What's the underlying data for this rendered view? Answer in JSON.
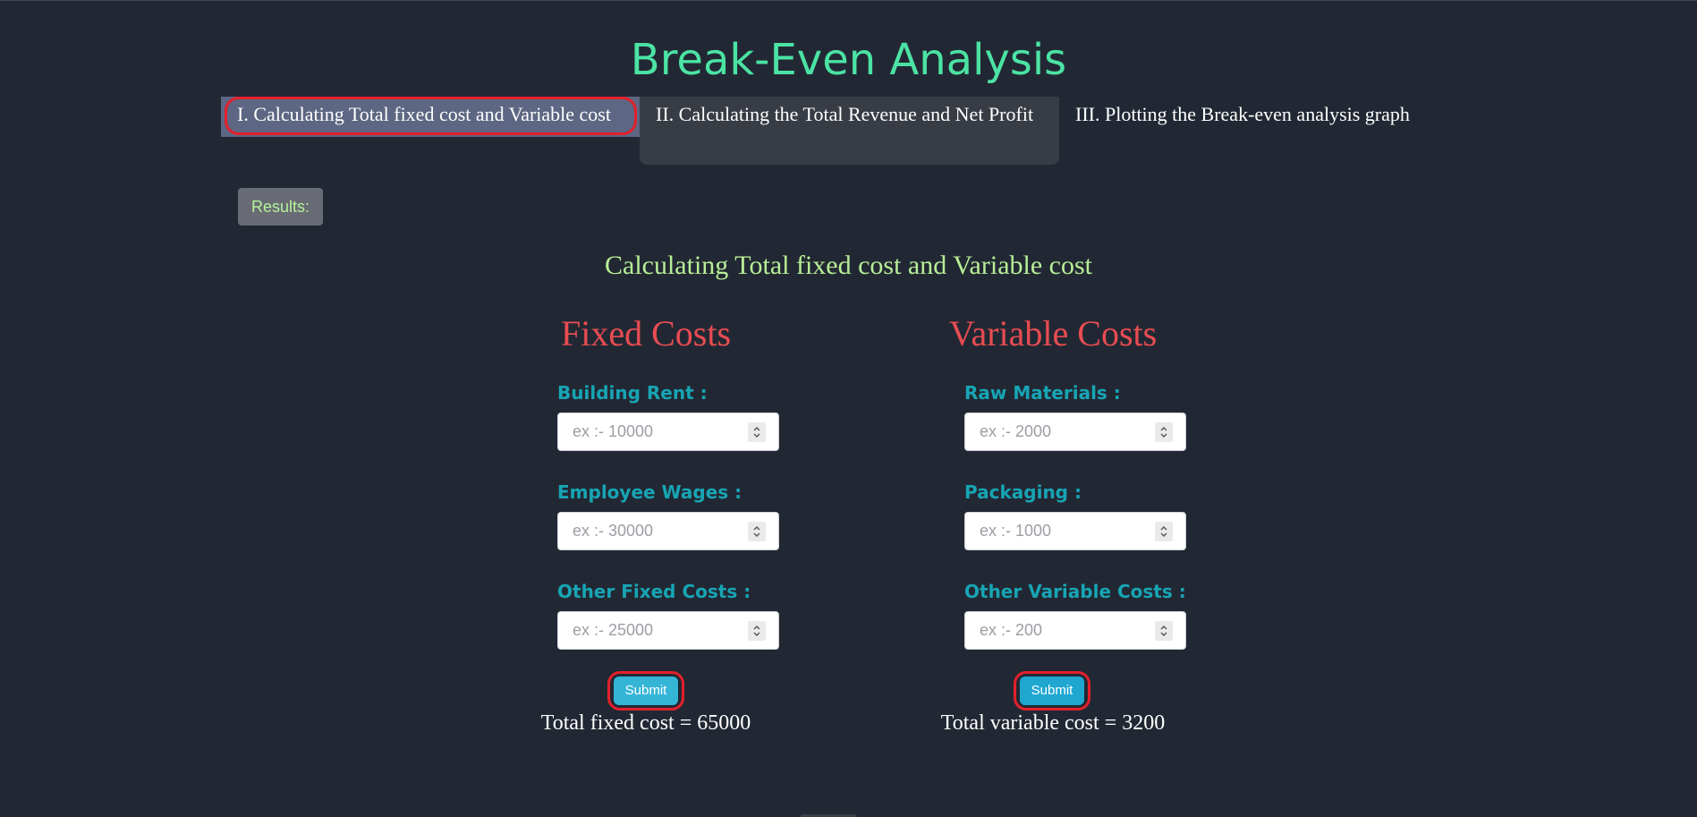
{
  "header": {
    "title": "Break-Even Analysis"
  },
  "tabs": [
    {
      "label": "I. Calculating Total fixed cost and Variable cost",
      "active": true
    },
    {
      "label": "II. Calculating the Total Revenue and Net Profit",
      "active": false
    },
    {
      "label": "III. Plotting the Break-even analysis graph",
      "active": false
    }
  ],
  "results_button": {
    "label": "Results:"
  },
  "section": {
    "heading": "Calculating Total fixed cost and Variable cost"
  },
  "fixed": {
    "heading": "Fixed Costs",
    "fields": [
      {
        "label": "Building Rent :",
        "placeholder": "ex :- 10000",
        "value": ""
      },
      {
        "label": "Employee Wages :",
        "placeholder": "ex :- 30000",
        "value": ""
      },
      {
        "label": "Other Fixed Costs :",
        "placeholder": "ex :- 25000",
        "value": ""
      }
    ],
    "submit_label": "Submit",
    "total_text": "Total fixed cost = 65000"
  },
  "variable": {
    "heading": "Variable Costs",
    "fields": [
      {
        "label": "Raw Materials :",
        "placeholder": "ex :- 2000",
        "value": ""
      },
      {
        "label": "Packaging :",
        "placeholder": "ex :- 1000",
        "value": ""
      },
      {
        "label": "Other Variable Costs :",
        "placeholder": "ex :- 200",
        "value": ""
      }
    ],
    "submit_label": "Submit",
    "total_text": "Total variable cost = 3200"
  },
  "colors": {
    "background": "#222833",
    "title": "#4be3a4",
    "section_heading": "#b8ee97",
    "column_heading": "#e84c52",
    "field_label": "#17a5b5",
    "active_tab": "#5d6783",
    "submit": "#35b5d6",
    "highlight_ring": "#e3202c"
  }
}
